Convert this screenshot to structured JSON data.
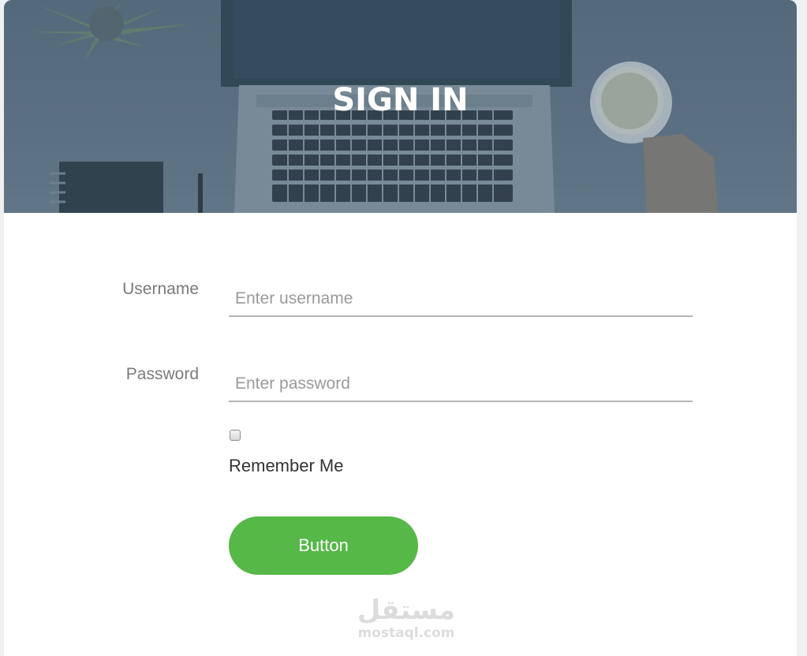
{
  "hero": {
    "title": "SIGN IN",
    "image_alt": "laptop-desk-photo"
  },
  "form": {
    "username_label": "Username",
    "username_placeholder": "Enter username",
    "username_value": "",
    "password_label": "Password",
    "password_placeholder": "Enter password",
    "password_value": "",
    "remember_label": "Remember Me",
    "remember_checked": false,
    "submit_label": "Button"
  },
  "watermark": {
    "arabic": "مستقل",
    "latin": "mostaql.com"
  },
  "colors": {
    "accent": "#55b847",
    "hero_tint": "#64788a",
    "label": "#7a7a7a"
  }
}
